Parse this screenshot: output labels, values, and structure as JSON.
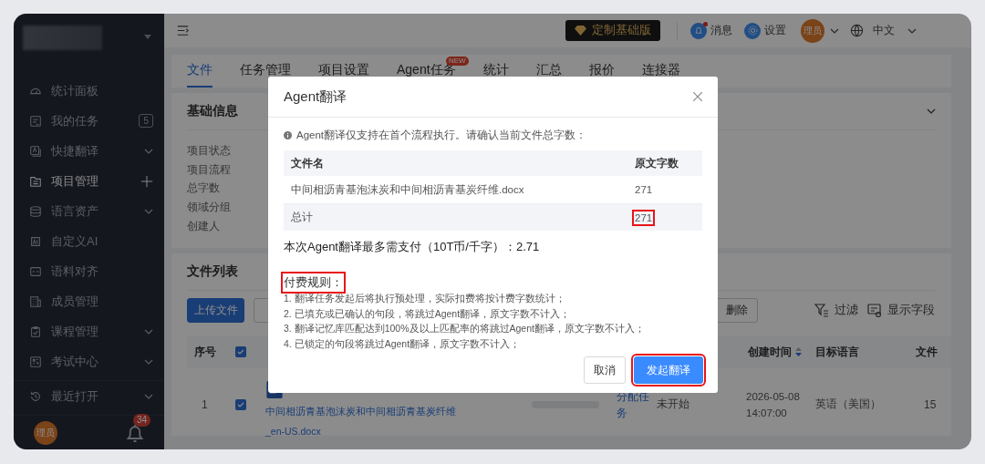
{
  "sidebar": {
    "items": [
      {
        "label": "统计面板",
        "selected": false,
        "kind": "plain"
      },
      {
        "label": "我的任务",
        "selected": false,
        "kind": "count",
        "count": "5"
      },
      {
        "label": "快捷翻译",
        "selected": false,
        "kind": "group"
      },
      {
        "label": "项目管理",
        "selected": true,
        "kind": "add"
      },
      {
        "label": "语言资产",
        "selected": false,
        "kind": "group"
      },
      {
        "label": "自定义AI",
        "selected": false,
        "kind": "plain"
      },
      {
        "label": "语料对齐",
        "selected": false,
        "kind": "plain"
      },
      {
        "label": "成员管理",
        "selected": false,
        "kind": "plain"
      },
      {
        "label": "课程管理",
        "selected": false,
        "kind": "group"
      },
      {
        "label": "考试中心",
        "selected": false,
        "kind": "group"
      }
    ],
    "recent": {
      "label": "最近打开",
      "kind": "group"
    },
    "avatar": "理员",
    "notifications": "34"
  },
  "header": {
    "plan": "定制基础版",
    "messages": {
      "label": "消息",
      "unread": true
    },
    "settings": "设置",
    "avatar": "理员",
    "language": "中文"
  },
  "tabs": [
    {
      "label": "文件",
      "selected": true
    },
    {
      "label": "任务管理",
      "selected": false
    },
    {
      "label": "项目设置",
      "selected": false
    },
    {
      "label": "Agent任务",
      "selected": false,
      "badge": "NEW"
    },
    {
      "label": "统计",
      "selected": false
    },
    {
      "label": "汇总",
      "selected": false
    },
    {
      "label": "报价",
      "selected": false
    },
    {
      "label": "连接器",
      "selected": false
    }
  ],
  "basic_info": {
    "title": "基础信息",
    "fields": [
      {
        "label": "项目状态"
      },
      {
        "label": "项目流程"
      },
      {
        "label": "总字数"
      },
      {
        "label": "领域分组"
      },
      {
        "label": "创建人"
      }
    ]
  },
  "file_list": {
    "title": "文件列表",
    "toolbar": {
      "buttons": [
        {
          "label": "上传文件",
          "kind": "primary"
        },
        {
          "kind": "default"
        }
      ],
      "delete": "删除",
      "filter": "过滤",
      "fields": "显示字段"
    },
    "table": {
      "columns": [
        {
          "label": "序号",
          "kind": "text"
        },
        {
          "kind": "checkbox",
          "checked": true
        },
        {
          "label": "创建时间",
          "kind": "sortable"
        },
        {
          "label": "目标语言",
          "kind": "text"
        },
        {
          "label": "文件",
          "kind": "text"
        }
      ],
      "rows": [
        {
          "index": "1",
          "checked": true,
          "file": "中间相沥青基泡沫炭和中间相沥青基炭纤维_en-US.docx",
          "action": "分配任务",
          "status": "未开始",
          "created": "2026-05-08 14:07:00",
          "target_language": "英语（美国）",
          "column_9": "15"
        }
      ]
    }
  },
  "dialog": {
    "title": "Agent翻译",
    "notice": "Agent翻译仅支持在首个流程执行。请确认当前文件总字数：",
    "table": {
      "columns": [
        "文件名",
        "原文字数"
      ],
      "rows": [
        {
          "name": "中间相沥青基泡沫炭和中间相沥青基炭纤维.docx",
          "count": "271"
        }
      ],
      "total": {
        "label": "总计",
        "count": "271",
        "highlighted": true
      }
    },
    "cost": "本次Agent翻译最多需支付（10T币/千字）：2.71",
    "rules": {
      "title": "付费规则：",
      "highlighted": true,
      "items": [
        "1. 翻译任务发起后将执行预处理，实际扣费将按计费字数统计；",
        "2. 已填充或已确认的句段，将跳过Agent翻译，原文字数不计入；",
        "3. 翻译记忆库匹配达到100%及以上匹配率的将跳过Agent翻译，原文字数不计入；",
        "4. 已锁定的句段将跳过Agent翻译，原文字数不计入；"
      ]
    },
    "buttons": [
      {
        "label": "取消",
        "kind": "secondary",
        "highlighted": false
      },
      {
        "label": "发起翻译",
        "kind": "primary",
        "highlighted": true
      }
    ]
  }
}
